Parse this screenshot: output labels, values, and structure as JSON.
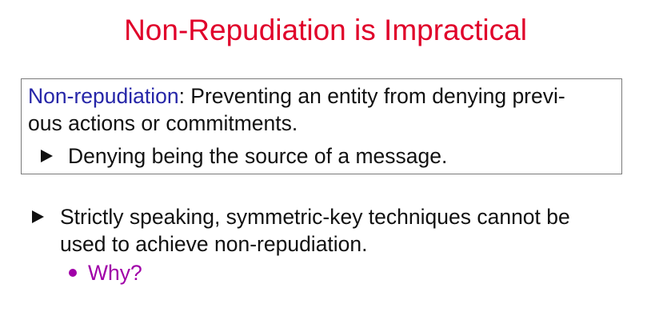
{
  "slide": {
    "title": "Non-Repudiation is Impractical",
    "definition": {
      "term": "Non-repudiation",
      "text_line1": ": Preventing an entity from denying previ-",
      "text_line2": "ous actions or commitments.",
      "bullet": "Denying being the source of a message."
    },
    "bullets": [
      {
        "line1": "Strictly speaking, symmetric-key techniques cannot be",
        "line2": "used to achieve non-repudiation.",
        "sub_bullets": [
          "Why?"
        ]
      }
    ]
  },
  "colors": {
    "title": "#e0002a",
    "term": "#2626a8",
    "sub_bullet": "#a000a8",
    "text": "#111111"
  }
}
